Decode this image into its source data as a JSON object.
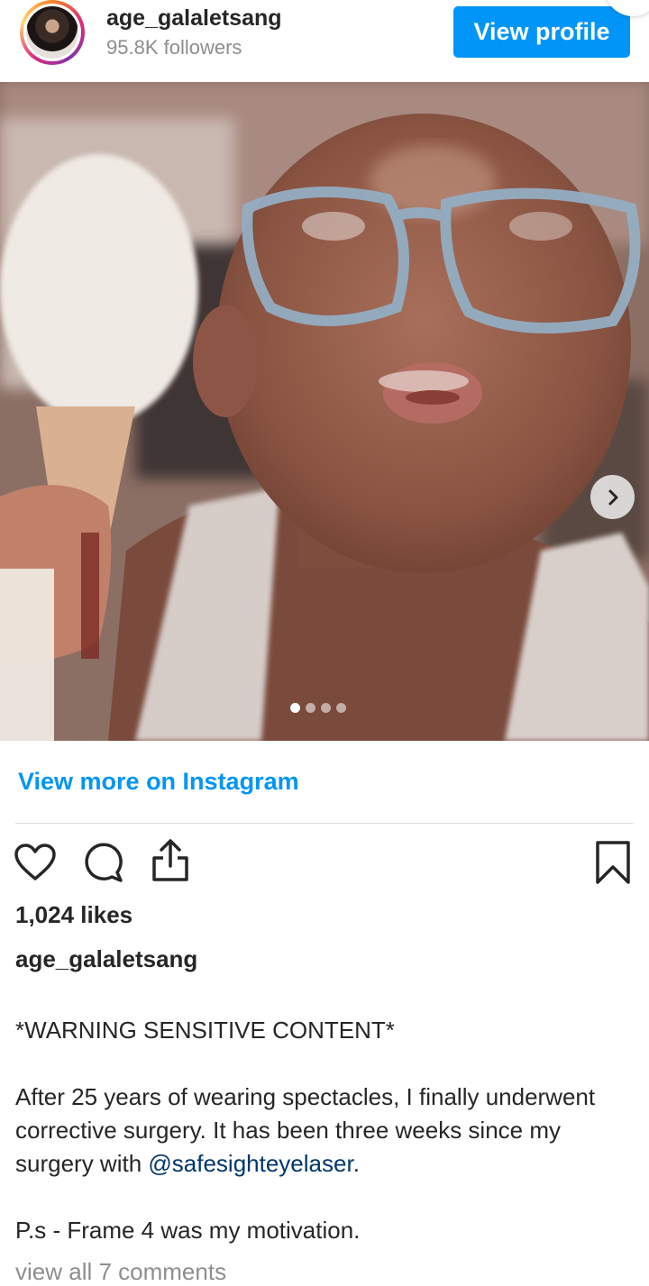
{
  "header": {
    "username": "age_galaletsang",
    "followers": "95.8K followers",
    "view_profile_label": "View profile",
    "avatar_icon": "profile-photo"
  },
  "carousel": {
    "slide_count": 4,
    "active_slide": 1,
    "next_icon": "chevron-right-icon"
  },
  "view_more": "View more on Instagram",
  "actions": {
    "like_icon": "heart-icon",
    "comment_icon": "comment-icon",
    "share_icon": "share-icon",
    "save_icon": "bookmark-icon"
  },
  "likes": "1,024 likes",
  "caption": {
    "username": "age_galaletsang",
    "warning": "*WARNING SENSITIVE CONTENT*",
    "body_before_mention": "After 25 years of wearing spectacles, I finally underwent corrective surgery. It has been three weeks since my surgery with ",
    "mention": "@safesighteyelaser",
    "body_after_mention": ".",
    "ps": "P.s - Frame 4 was my motivation."
  },
  "comments_link": "view all 7 comments",
  "colors": {
    "primary_blue": "#0095f6",
    "mention_blue": "#00376b",
    "secondary_text": "#8e8e8e"
  }
}
